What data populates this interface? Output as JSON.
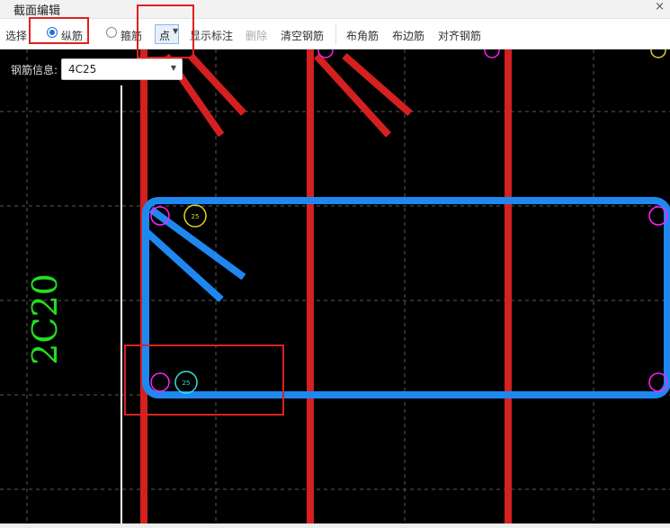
{
  "window": {
    "title": "截面编辑",
    "close_glyph": "×"
  },
  "toolbar": {
    "select_label": "选择",
    "radio_longitudinal": {
      "label": "纵筋",
      "checked": true
    },
    "radio_stirrup": {
      "label": "箍筋",
      "checked": false
    },
    "mode_dropdown": {
      "value": "点"
    },
    "show_annotation": "显示标注",
    "delete": "删除",
    "clear_rebar": "清空钢筋",
    "place_corner": "布角筋",
    "place_edge": "布边筋",
    "align_rebar": "对齐钢筋"
  },
  "rebar_info": {
    "label": "钢筋信息:",
    "value": "4C25"
  },
  "drawing": {
    "dimension_label": "2C20",
    "bar_labels": {
      "corner": "25",
      "plain": "25"
    },
    "colors": {
      "background": "#000000",
      "red_rebar": "#d42020",
      "blue_stirrup": "#1e88f0",
      "magenta_point": "#ff20ff",
      "yellow_point": "#e8d020",
      "cyan_point": "#30e0e0",
      "green_text": "#22dd22"
    }
  }
}
